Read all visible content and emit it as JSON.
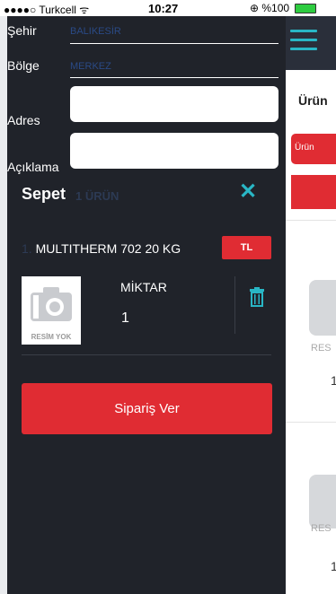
{
  "status_bar": {
    "carrier": "●●●●○ Turkcell ᯤ",
    "time": "10:27",
    "battery": "⊕ %100"
  },
  "form": {
    "city_label": "Şehir",
    "city_value": "BALIKESİR",
    "district_label": "Bölge",
    "district_value": "MERKEZ",
    "address_label": "Adres",
    "note_label": "Açıklama"
  },
  "cart": {
    "title": "Sepet",
    "count": "1 ÜRÜN",
    "item_index": "1.",
    "item_name": "MULTITHERM 702 20 KG",
    "currency": "TL",
    "no_image": "RESİM YOK",
    "qty_label": "MİKTAR",
    "qty_value": "1",
    "order_button": "Sipariş Ver"
  },
  "right": {
    "heading": "Ürün",
    "red_button": "Ürün",
    "no_image_1": "RES",
    "qty_1": "1",
    "no_image_2": "RES",
    "qty_2": "1"
  },
  "colors": {
    "drawer_bg": "#20232a",
    "accent_red": "#e02c33",
    "accent_teal": "#29b6c5"
  }
}
